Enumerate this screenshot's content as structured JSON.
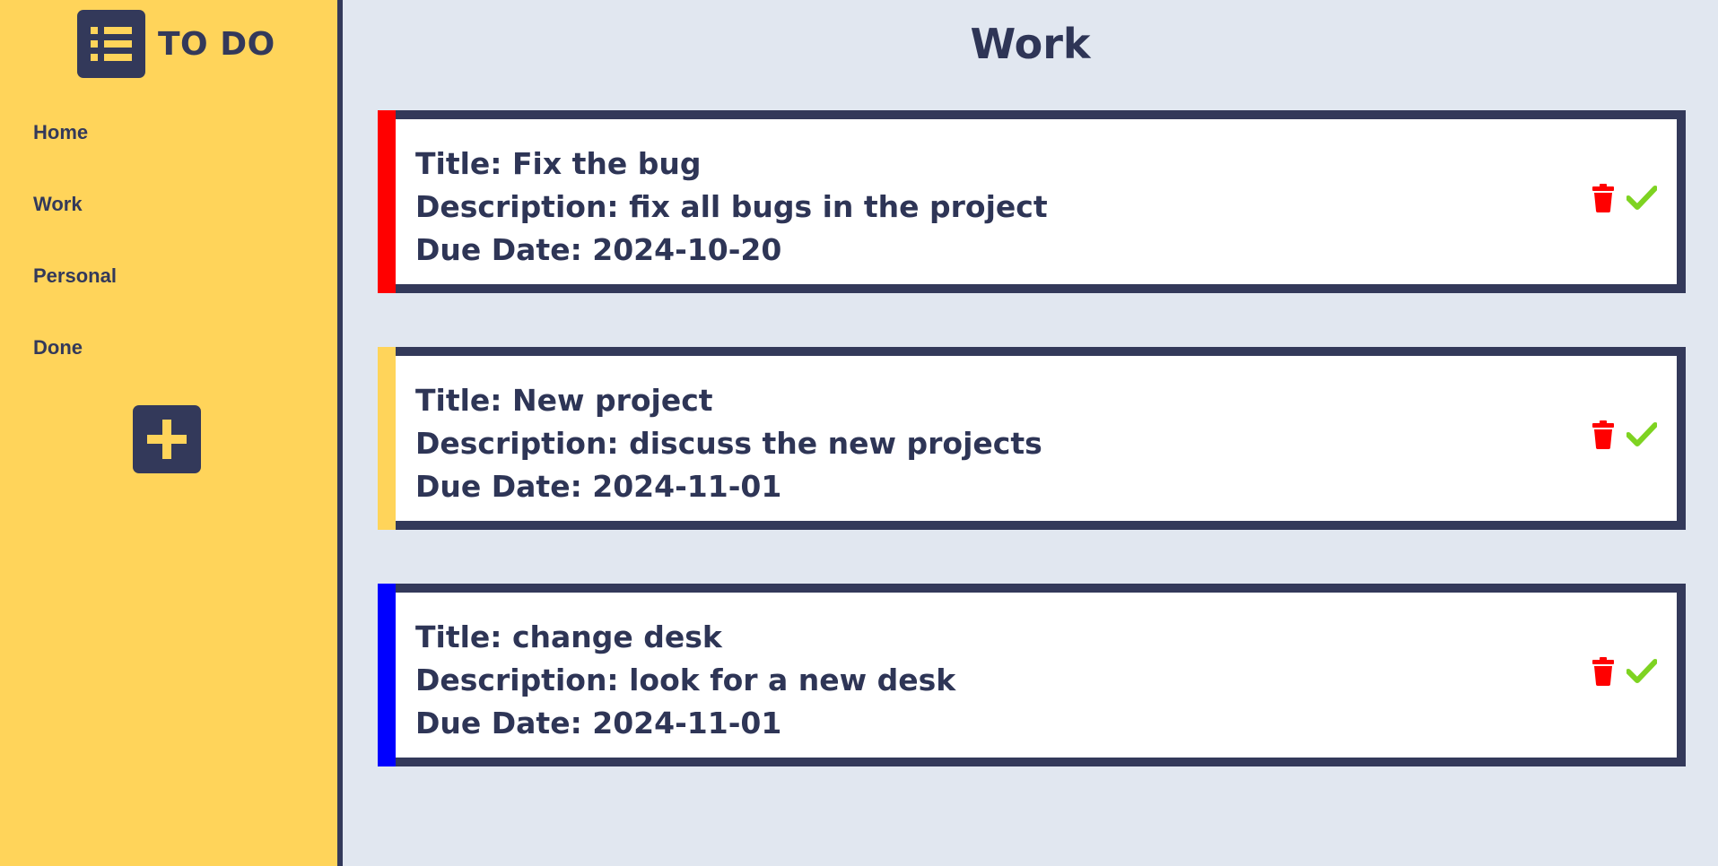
{
  "app": {
    "logo_text": "TO DO",
    "logo_icon": "list-icon"
  },
  "sidebar": {
    "items": [
      {
        "label": "Home"
      },
      {
        "label": "Work"
      },
      {
        "label": "Personal"
      },
      {
        "label": "Done"
      }
    ],
    "add_icon": "plus-icon"
  },
  "main": {
    "title": "Work",
    "tasks": [
      {
        "title": "Title: Fix the bug",
        "description": "Description: fix all bugs in the project",
        "due": "Due Date: 2024-10-20",
        "priority_color": "#ff0000"
      },
      {
        "title": "Title: New project",
        "description": "Description: discuss the new projects",
        "due": "Due Date: 2024-11-01",
        "priority_color": "#ffd45a"
      },
      {
        "title": "Title: change desk",
        "description": "Description: look for a new desk",
        "due": "Due Date: 2024-11-01",
        "priority_color": "#0000ff"
      }
    ]
  },
  "colors": {
    "sidebar_bg": "#ffd45a",
    "navy": "#33395a",
    "page_bg": "#e1e7f0",
    "delete": "#ff0000",
    "complete": "#7ed321"
  }
}
